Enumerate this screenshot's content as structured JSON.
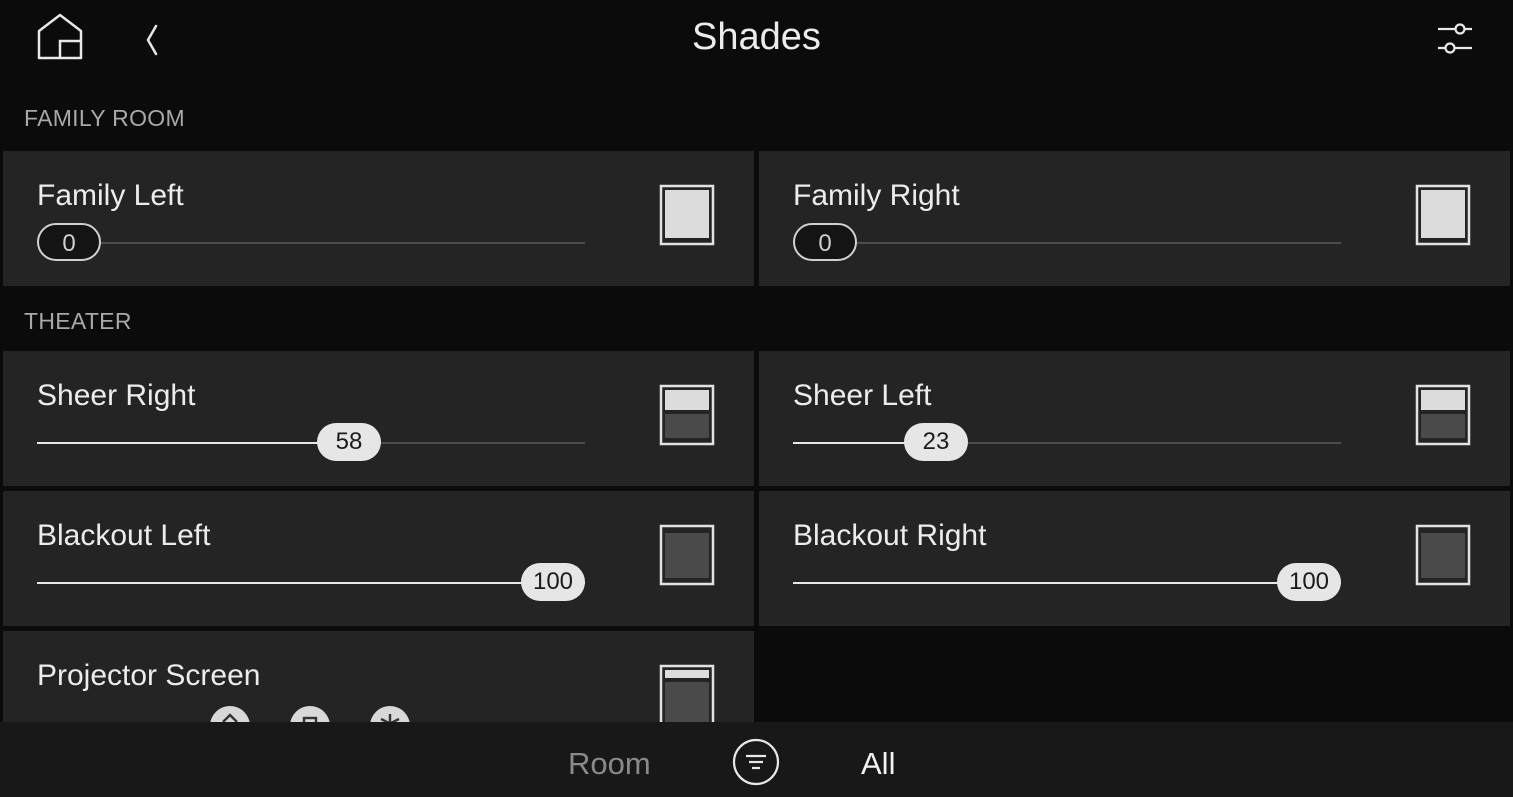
{
  "header": {
    "title": "Shades",
    "home_icon": "home-icon",
    "back_icon": "chevron-left-icon",
    "filter_icon": "sliders-icon"
  },
  "sections": [
    {
      "label": "FAMILY ROOM"
    },
    {
      "label": "THEATER"
    }
  ],
  "shades": [
    {
      "name": "Family Left",
      "level": 0,
      "value_label": "0"
    },
    {
      "name": "Family Right",
      "level": 0,
      "value_label": "0"
    },
    {
      "name": "Sheer Right",
      "level": 58,
      "value_label": "58"
    },
    {
      "name": "Sheer Left",
      "level": 23,
      "value_label": "23"
    },
    {
      "name": "Blackout Left",
      "level": 100,
      "value_label": "100"
    },
    {
      "name": "Blackout Right",
      "level": 100,
      "value_label": "100"
    }
  ],
  "projector": {
    "name": "Projector Screen",
    "controls": [
      "up-down-icon",
      "stop-icon",
      "preset-icon"
    ]
  },
  "bottom_bar": {
    "room_label": "Room",
    "all_label": "All",
    "filter_icon": "filter-lines-icon"
  },
  "colors": {
    "background": "#0b0b0b",
    "card": "#242424",
    "accent": "#e8e8e8"
  }
}
